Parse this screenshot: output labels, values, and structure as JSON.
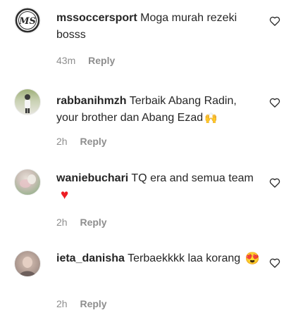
{
  "comments": [
    {
      "username": "mssoccersport",
      "text": "Moga murah rezeki bosss",
      "emoji": "",
      "time": "43m",
      "reply_label": "Reply",
      "avatar_icon": "ms-logo-avatar",
      "avatar_initials": "MS"
    },
    {
      "username": "rabbanihmzh",
      "text": "Terbaik Abang Radin, your brother dan Abang Ezad",
      "emoji": "🙌",
      "time": "2h",
      "reply_label": "Reply",
      "avatar_icon": "person-photo-avatar"
    },
    {
      "username": "waniebuchari",
      "text": "TQ era and semua team",
      "emoji": "♥",
      "time": "2h",
      "reply_label": "Reply",
      "avatar_icon": "photo-avatar"
    },
    {
      "username": "ieta_danisha",
      "text": "Terbaekkkk laa korang",
      "emoji": "😍",
      "time": "2h",
      "reply_label": "Reply",
      "avatar_icon": "photo-avatar"
    }
  ],
  "colors": {
    "text": "#262626",
    "meta": "#8e8e8e",
    "heart_emoji": "#ed1c24"
  }
}
